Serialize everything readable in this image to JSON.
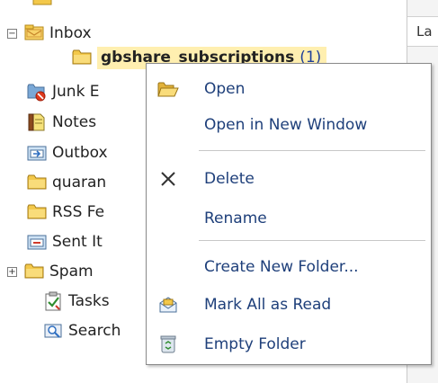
{
  "header_column_label": "La",
  "folders": [
    {
      "label": "Inbox",
      "icon": "inbox-icon",
      "expander": "⊟"
    },
    {
      "label": "gbshare_subscriptions",
      "count": "(1)",
      "icon": "folder-icon",
      "selected": true
    },
    {
      "label": "Junk E",
      "icon": "junk-folder-icon"
    },
    {
      "label": "Notes",
      "icon": "notes-icon"
    },
    {
      "label": "Outbox",
      "icon": "outbox-icon"
    },
    {
      "label": "quaran",
      "icon": "folder-icon"
    },
    {
      "label": "RSS Fe",
      "icon": "folder-icon"
    },
    {
      "label": "Sent It",
      "icon": "sent-items-icon"
    },
    {
      "label": "Spam",
      "icon": "folder-icon",
      "expander": "⊞"
    },
    {
      "label": "Tasks",
      "icon": "tasks-icon"
    },
    {
      "label": "Search",
      "icon": "search-folder-icon"
    }
  ],
  "context_menu": {
    "items": [
      {
        "label": "Open",
        "icon": "open-folder-icon"
      },
      {
        "label": "Open in New Window",
        "icon": ""
      },
      {
        "label": "Delete",
        "icon": "delete-x-icon"
      },
      {
        "label": "Rename",
        "icon": ""
      },
      {
        "label": "Create New Folder...",
        "icon": ""
      },
      {
        "label": "Mark All as Read",
        "icon": "envelope-read-icon"
      },
      {
        "label": "Empty Folder",
        "icon": "recycle-bin-icon"
      }
    ]
  },
  "colors": {
    "menu_text": "#1e3f7a",
    "selected_bg": "#ffefb0",
    "folder_yellow": "#f3c84a"
  }
}
